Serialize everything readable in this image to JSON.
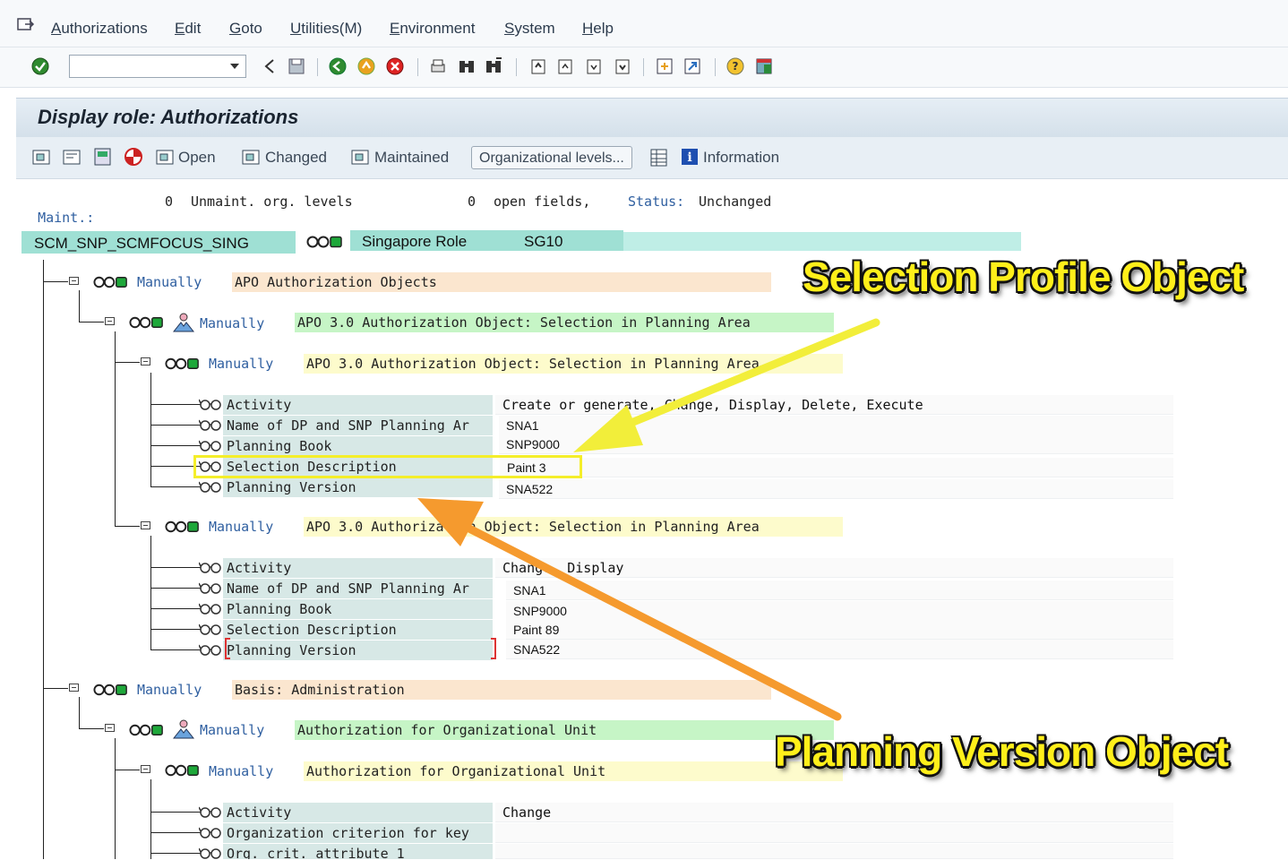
{
  "menu": [
    "Authorizations",
    "Edit",
    "Goto",
    "Utilities(M)",
    "Environment",
    "System",
    "Help"
  ],
  "title": "Display role: Authorizations",
  "app_toolbar": {
    "open": "Open",
    "changed": "Changed",
    "maintained": "Maintained",
    "org_levels": "Organizational levels...",
    "information": "Information"
  },
  "status": {
    "maint_label": "Maint.:",
    "maint_value": "0",
    "unmaint_label": "Unmaint. org. levels",
    "unmaint_value": "0",
    "open_fields": "open fields,",
    "status_label": "Status:",
    "status_value": "Unchanged"
  },
  "role": {
    "name": "SCM_SNP_SCMFOCUS_SING",
    "description": "Singapore Role",
    "code": "SG10"
  },
  "tree": {
    "n1": {
      "status": "Manually",
      "text": "APO Authorization Objects"
    },
    "n2": {
      "status": "Manually",
      "text": "APO 3.0 Authorization Object: Selection in Planning Area"
    },
    "n3": {
      "status": "Manually",
      "text": "APO 3.0 Authorization Object: Selection in Planning Area",
      "fields": [
        {
          "label": "Activity",
          "value": "Create or generate, Change, Display, Delete, Execute"
        },
        {
          "label": "Name of DP and SNP Planning Ar",
          "value": "SNA1"
        },
        {
          "label": "Planning Book",
          "value": "SNP9000"
        },
        {
          "label": "Selection Description",
          "value": "Paint 3"
        },
        {
          "label": "Planning Version",
          "value": "SNA522"
        }
      ]
    },
    "n4": {
      "status": "Manually",
      "text": "APO 3.0 Authorization Object: Selection in Planning Area",
      "fields": [
        {
          "label": "Activity",
          "value": "Change, Display"
        },
        {
          "label": "Name of DP and SNP Planning Ar",
          "value": "SNA1"
        },
        {
          "label": "Planning Book",
          "value": "SNP9000"
        },
        {
          "label": "Selection Description",
          "value": "Paint 89"
        },
        {
          "label": "Planning Version",
          "value": "SNA522"
        }
      ]
    },
    "n5": {
      "status": "Manually",
      "text": "Basis: Administration"
    },
    "n6": {
      "status": "Manually",
      "text": "Authorization for Organizational Unit"
    },
    "n7": {
      "status": "Manually",
      "text": "Authorization for Organizational Unit",
      "fields": [
        {
          "label": "Activity",
          "value": "Change"
        },
        {
          "label": "Organization criterion for key",
          "value": ""
        },
        {
          "label": "Org. crit. attribute 1",
          "value": ""
        }
      ]
    }
  },
  "callouts": {
    "selection_profile": "Selection Profile Object",
    "planning_version": "Planning Version Object"
  },
  "colors": {
    "callout_yellow": "#ffef1a",
    "arrow_yellow": "#f2ee3a",
    "arrow_orange": "#f59a2e"
  }
}
